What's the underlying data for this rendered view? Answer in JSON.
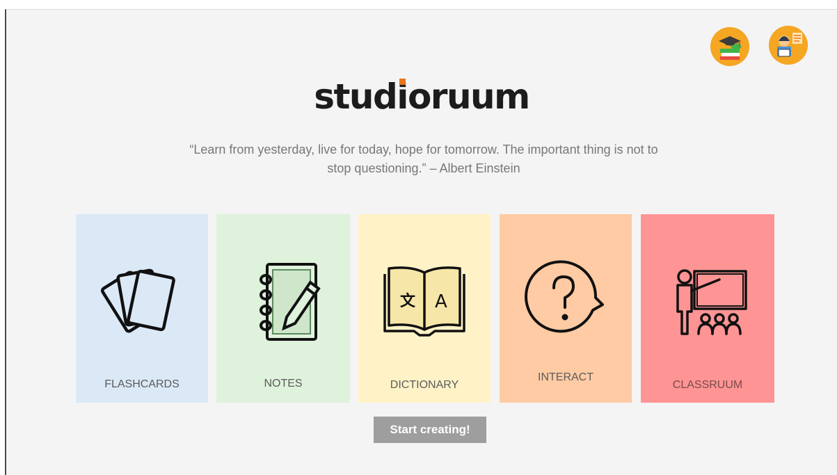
{
  "brand": {
    "logo_prefix": "stud",
    "logo_i": "i",
    "logo_suffix": "oruum",
    "accent": "#e8761e"
  },
  "quote": "“Learn from yesterday, live for today, hope for tomorrow. The important thing is not to stop questioning.” – Albert Einstein",
  "header": {
    "avatars": [
      {
        "icon": "graduation-books-icon"
      },
      {
        "icon": "reading-student-icon"
      }
    ]
  },
  "tiles": [
    {
      "label": "FLASHCARDS",
      "icon": "flashcards-icon",
      "color": "#dbe9f7"
    },
    {
      "label": "NOTES",
      "icon": "notebook-pencil-icon",
      "color": "#dff2dc"
    },
    {
      "label": "DICTIONARY",
      "icon": "translate-book-icon",
      "color": "#fff2c7"
    },
    {
      "label": "INTERACT",
      "icon": "question-bubble-icon",
      "color": "#ffcba4"
    },
    {
      "label": "CLASSRUUM",
      "icon": "classroom-teacher-icon",
      "color": "#ff9494"
    }
  ],
  "cta": {
    "label": "Start creating!"
  }
}
